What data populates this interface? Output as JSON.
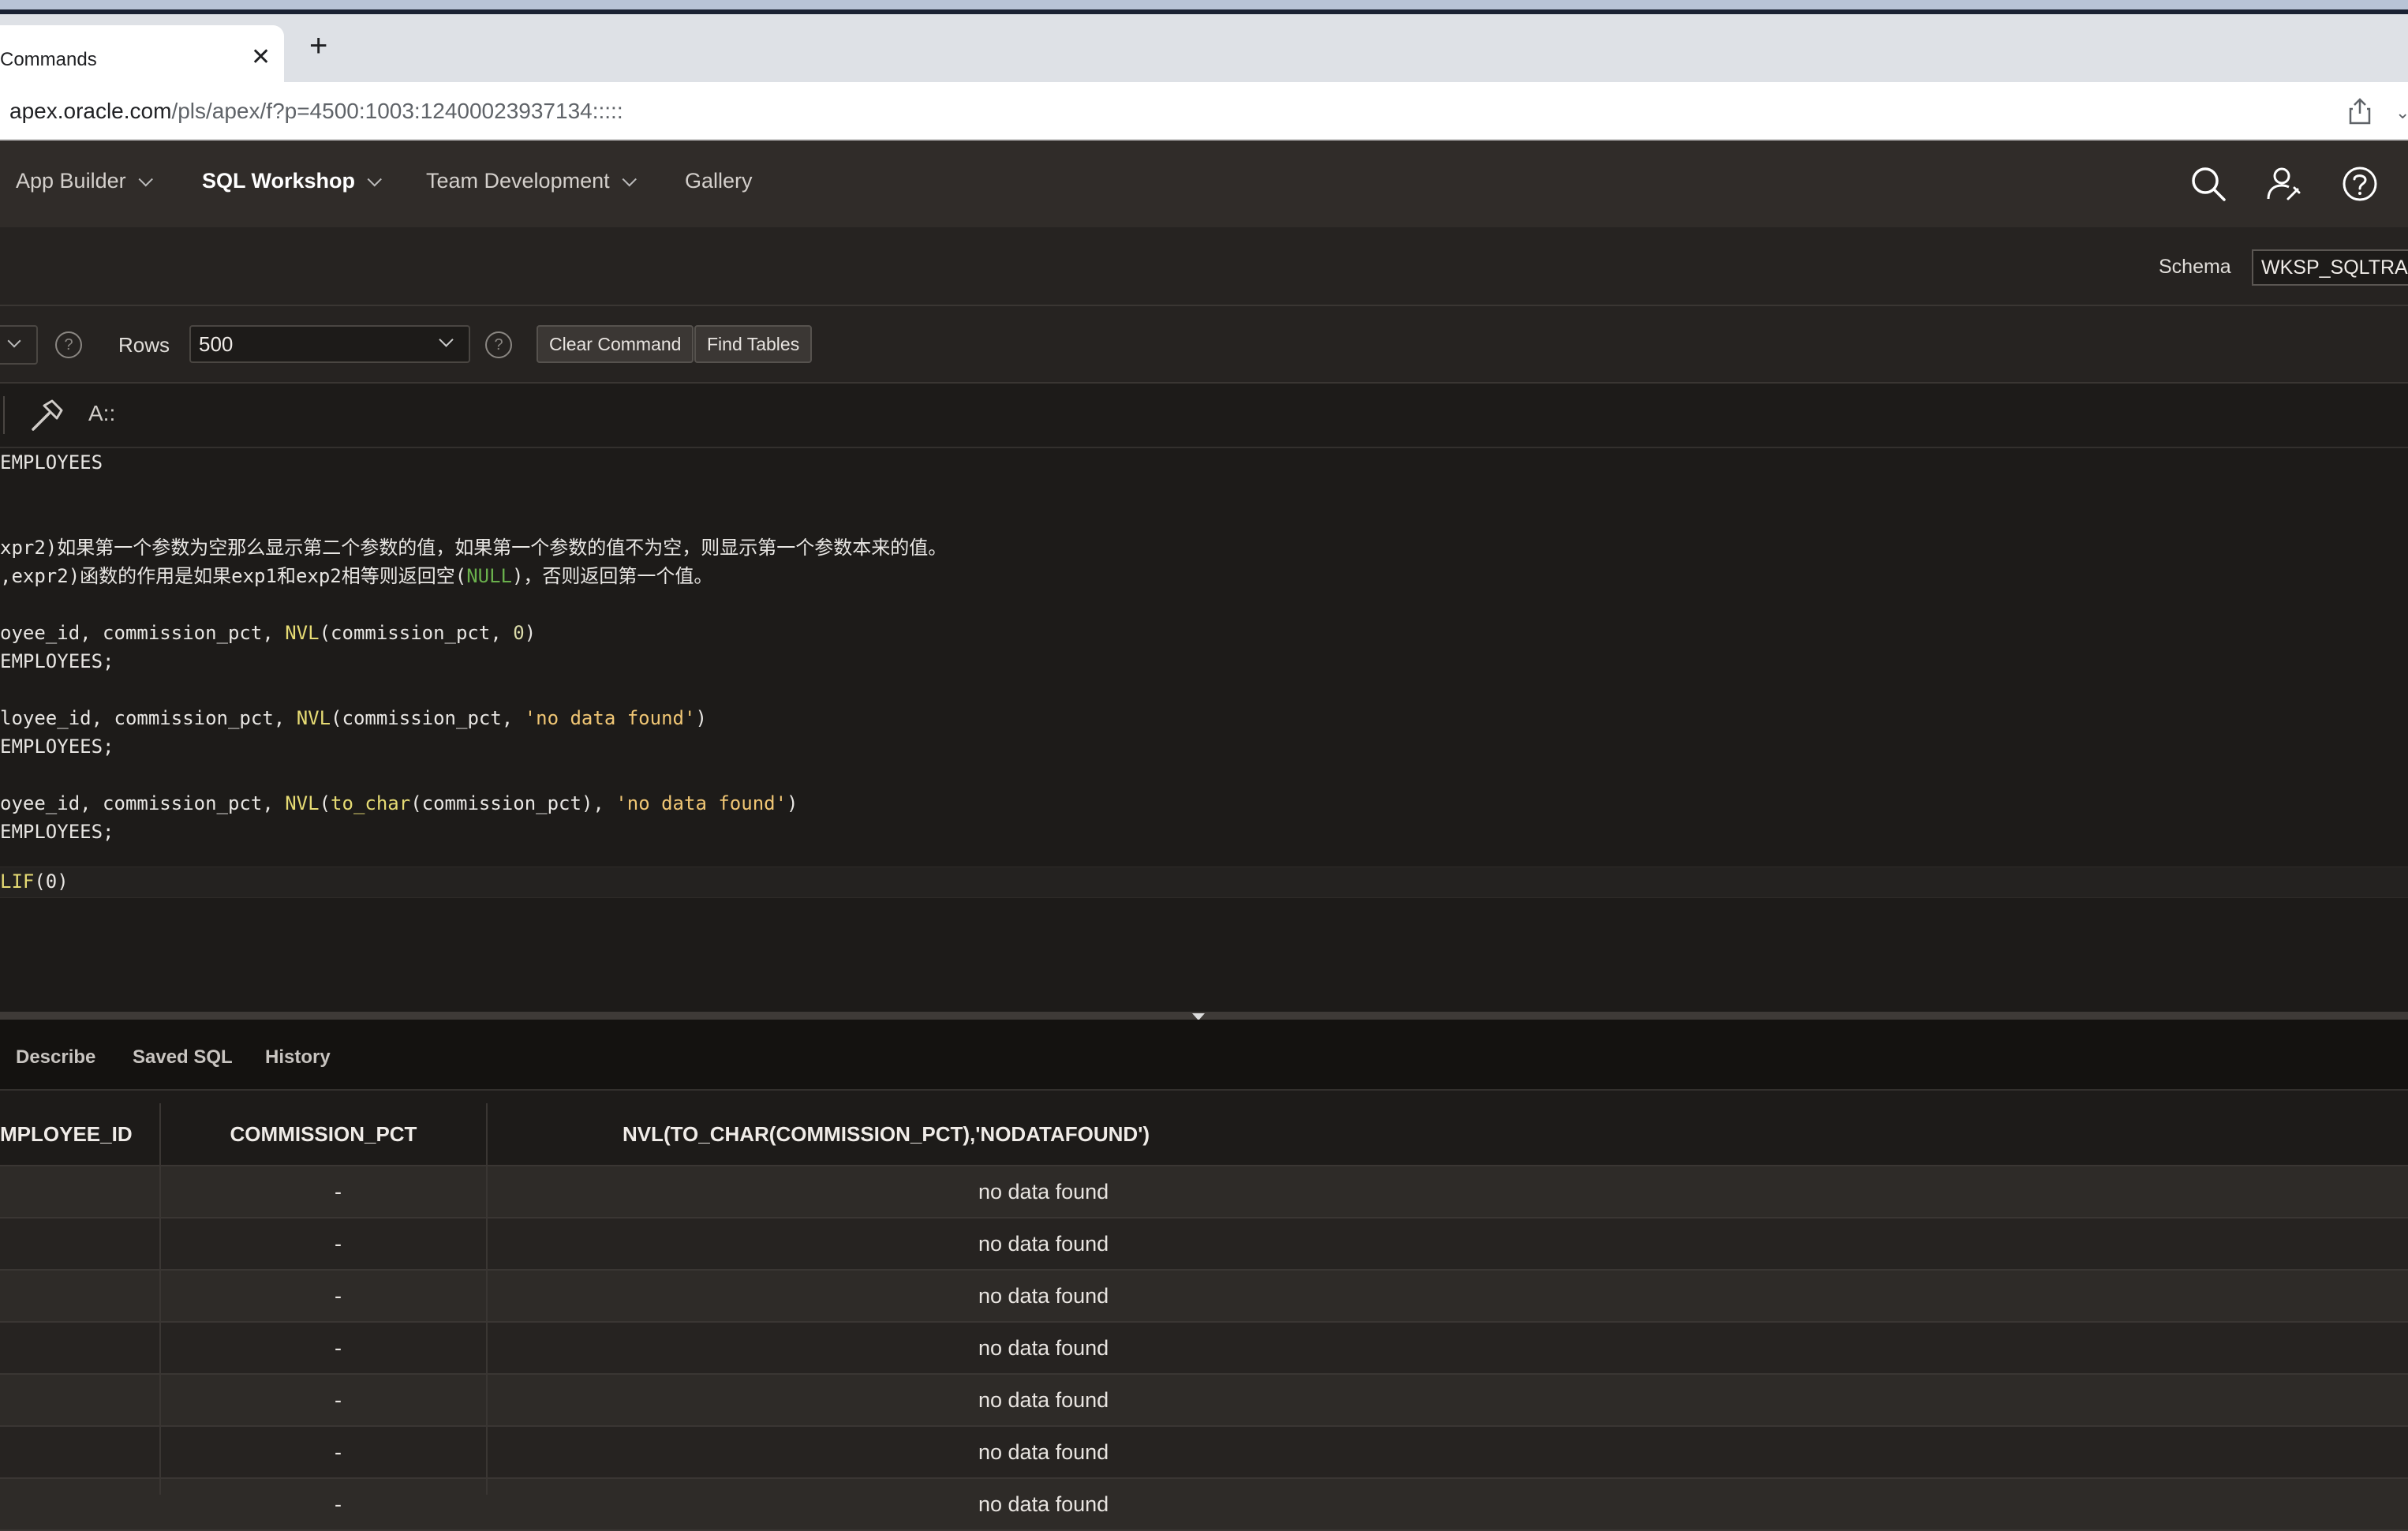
{
  "browser": {
    "tab_title": "Commands",
    "tab_title_full": "SQL Commands",
    "url_host": "apex.oracle.com",
    "url_path": "/pls/apex/f?p=4500:1003:12400023937134:::::"
  },
  "nav": {
    "items": [
      {
        "label": "App Builder",
        "dropdown": true
      },
      {
        "label": "SQL Workshop",
        "dropdown": true,
        "active": true
      },
      {
        "label": "Team Development",
        "dropdown": true
      },
      {
        "label": "Gallery",
        "dropdown": false
      }
    ]
  },
  "schema": {
    "label": "Schema",
    "value": "WKSP_SQLTRAIN"
  },
  "toolbar": {
    "rows_label": "Rows",
    "rows_value": "500",
    "help_glyph": "?",
    "clear_label": "Clear Command",
    "find_label": "Find Tables",
    "format_label": "A::"
  },
  "editor": {
    "lines": [
      "EMPLOYEES",
      "",
      "",
      "xpr2)如果第一个参数为空那么显示第二个参数的值，如果第一个参数的值不为空，则显示第一个参数本来的值。",
      ",expr2)函数的作用是如果exp1和exp2相等则返回空(NULL)，否则返回第一个值。",
      "",
      "oyee_id, commission_pct, NVL(commission_pct, 0)",
      "EMPLOYEES;",
      "",
      "loyee_id, commission_pct, NVL(commission_pct, 'no data found')",
      "EMPLOYEES;",
      "",
      "oyee_id, commission_pct, NVL(to_char(commission_pct), 'no data found')",
      "EMPLOYEES;",
      "",
      "LIF(0)"
    ]
  },
  "result_tabs": [
    "Describe",
    "Saved SQL",
    "History"
  ],
  "table": {
    "columns": [
      "MPLOYEE_ID",
      "COMMISSION_PCT",
      "NVL(TO_CHAR(COMMISSION_PCT),'NODATAFOUND')"
    ],
    "rows": [
      [
        "",
        "-",
        "no data found"
      ],
      [
        "",
        "-",
        "no data found"
      ],
      [
        "",
        "-",
        "no data found"
      ],
      [
        "",
        "-",
        "no data found"
      ],
      [
        "",
        "-",
        "no data found"
      ],
      [
        "",
        "-",
        "no data found"
      ],
      [
        "",
        "-",
        "no data found"
      ]
    ]
  },
  "colors": {
    "nav_bg": "#302c29",
    "toolbar_bg": "#262321",
    "editor_bg": "#1d1b19",
    "function_color": "#e6db74",
    "string_color": "#f0c674",
    "keyword_color": "#6ab04c"
  }
}
